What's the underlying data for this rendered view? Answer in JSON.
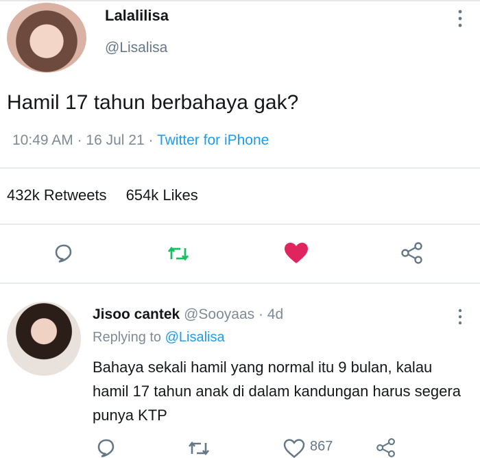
{
  "tweet": {
    "author_name": "Lalalilisa",
    "author_handle": "@Lisalisa",
    "text": "Hamil 17 tahun berbahaya gak?",
    "time": "10:49 AM",
    "date": "16 Jul 21",
    "source": "Twitter for iPhone",
    "retweets": "432k",
    "retweets_label": "Retweets",
    "likes": "654k",
    "likes_label": "Likes",
    "liked": true,
    "like_color": "#e0245e"
  },
  "reply": {
    "author_name": "Jisoo cantek",
    "author_handle": "@Sooyaas",
    "age": "4d",
    "replying_to_prefix": "Replying to",
    "replying_to_handle": "@Lisalisa",
    "text": "Bahaya sekali hamil yang normal itu 9 bulan, kalau hamil 17 tahun anak di dalam kandungan harus segera punya KTP",
    "like_count": "867"
  },
  "colors": {
    "accent": "#1d9bf0",
    "muted": "#7f8a95",
    "retweet_icon": "#17bf63"
  },
  "icons": {
    "reply": "reply-icon",
    "retweet": "retweet-icon",
    "like": "heart-icon",
    "share": "share-icon",
    "more": "more-vertical-icon"
  }
}
